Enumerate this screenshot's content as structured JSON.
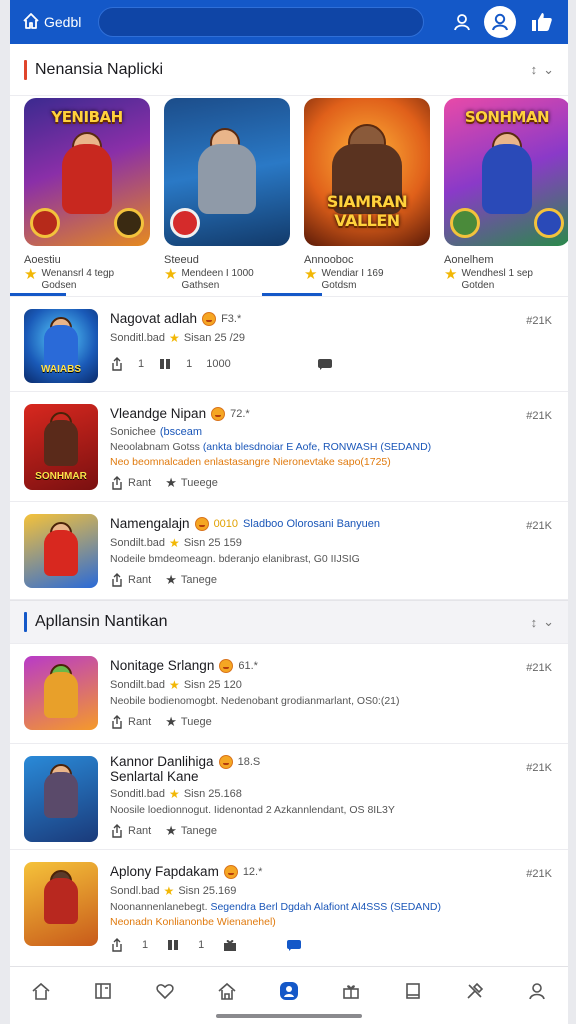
{
  "topbar": {
    "home_label": "Gedbl"
  },
  "section1": {
    "title": "Nenansia Naplicki"
  },
  "carousel": [
    {
      "art_title": "YENIBAH",
      "name": "Aoestiu",
      "sub1": "Wenansrl 4 tegp",
      "sub2": "Godsen"
    },
    {
      "art_title": "",
      "name": "Steeud",
      "sub1": "Mendeen I 1000",
      "sub2": "Gathsen"
    },
    {
      "art_title": "SIAMRAN VALLEN",
      "name": "Annooboc",
      "sub1": "Wendiar I 169",
      "sub2": "Gotdsm"
    },
    {
      "art_title": "SONHMAN",
      "name": "Aonelhem",
      "sub1": "Wendhesl 1 sep",
      "sub2": "Gotden"
    }
  ],
  "list1": [
    {
      "name": "Nagovat adlah",
      "rating": "F3.*",
      "extra": "",
      "rank": "#21K",
      "meta_a": "Sonditl.bad",
      "meta_b": "Sisan 25 /29",
      "desc": "",
      "desc_blue": "",
      "promo": "",
      "thumb_label": "WAIABS",
      "action1": "1",
      "action2": "1",
      "action3": "1000"
    },
    {
      "name": "Vleandge Nipan",
      "rating": "72.*",
      "extra": "",
      "rank": "#21K",
      "meta_a": "Sonichee",
      "meta_b": "(bsceam",
      "desc": "Neoolabnam Gotss",
      "desc_blue": "(ankta blesdnoiar E Aofe, RONWASH (SEDAND)",
      "promo": "Neo beomnalcaden enlastasangre Nieronevtake sapo(1725)",
      "thumb_label": "SONHMAR",
      "action1": "Rant",
      "action2": "Tueege"
    },
    {
      "name": "Namengalajn",
      "rating": "0010",
      "extra": "Sladboo Olorosani Banyuen",
      "rank": "#21K",
      "meta_a": "Sondilt.bad",
      "meta_b": "Sisn 25 159",
      "desc": "Nodeile bmdeomeagn. bderanjo elanibrast, G0 IIJSIG",
      "desc_blue": "",
      "promo": "",
      "thumb_label": "",
      "action1": "Rant",
      "action2": "Tanege"
    }
  ],
  "section2": {
    "title": "Apllansin Nantikan"
  },
  "list2": [
    {
      "name": "Nonitage Srlangn",
      "rating": "61.*",
      "extra": "",
      "rank": "#21K",
      "meta_a": "Sondilt.bad",
      "meta_b": "Sisn 25 120",
      "desc": "Neobile bodienomogbt. Nedenobant grodianmarlant, OS0:(21)",
      "desc_blue": "",
      "promo": "",
      "action1": "Rant",
      "action2": "Tuege"
    },
    {
      "name": "Kannor Danlihiga",
      "name2": "Senlartal Kane",
      "rating": "18.S",
      "extra": "",
      "rank": "#21K",
      "meta_a": "Sonditl.bad",
      "meta_b": "Sisn 25.168",
      "desc": "Noosile loedionnogut. Iidenontad 2 Azkannlendant, OS 8IL3Y",
      "desc_blue": "",
      "promo": "",
      "action1": "Rant",
      "action2": "Tanege"
    },
    {
      "name": "Aplony Fapdakam",
      "rating": "12.*",
      "extra": "",
      "rank": "#21K",
      "meta_a": "Sondl.bad",
      "meta_b": "Sisn 25.169",
      "desc": "Noonannenlanebegt.",
      "desc_blue": "Segendra Berl Dgdah Alafiont Al4SSS (SEDAND)",
      "promo": "Neonadn Konlianonbe Wienanehel)",
      "action1": "1",
      "action2": "1"
    }
  ],
  "colors": {
    "primary": "#1458c8",
    "section1_bar": "#e0452b",
    "section2_bar": "#1458c8",
    "promo": "#e07a0e",
    "star": "#f2b705"
  }
}
